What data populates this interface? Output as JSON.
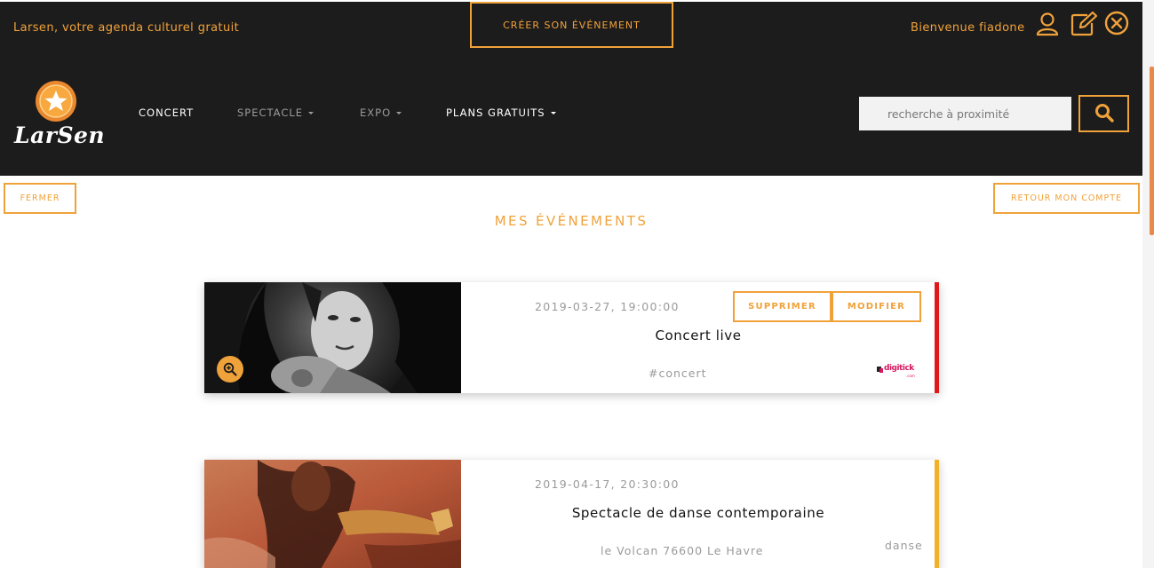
{
  "header": {
    "tagline": "Larsen, votre agenda culturel gratuit",
    "create_event_label": "CRÉER SON ÉVÉNEMENT",
    "welcome": "Bienvenue fiadone",
    "logo_text": "LarSen",
    "icons": [
      "user-icon",
      "edit-icon",
      "close-circle-icon"
    ]
  },
  "nav": {
    "items": [
      {
        "label": "CONCERT",
        "dropdown": false,
        "active": true
      },
      {
        "label": "SPECTACLE",
        "dropdown": true,
        "active": false
      },
      {
        "label": "EXPO",
        "dropdown": true,
        "active": false
      },
      {
        "label": "PLANS GRATUITS",
        "dropdown": true,
        "active": true
      }
    ]
  },
  "search": {
    "placeholder": "recherche à proximité",
    "value": ""
  },
  "subbar": {
    "close_label": "FERMER",
    "back_label": "RETOUR MON COMPTE"
  },
  "page": {
    "title": "MES ÉVÉNEMENTS"
  },
  "events": [
    {
      "datetime": "2019-03-27, 19:00:00",
      "title": "Concert live",
      "tag": "#concert",
      "delete_label": "SUPPRIMER",
      "edit_label": "MODIFIER",
      "partner": "digitick",
      "partner_sub": ".com",
      "accent_color": "#e01818"
    },
    {
      "datetime": "2019-04-17, 20:30:00",
      "title": "Spectacle de danse contemporaine",
      "location": "le Volcan 76600 Le Havre",
      "tag": "danse",
      "accent_color": "#f3b12a"
    }
  ],
  "colors": {
    "accent": "#f0a23a",
    "header_bg": "#1d1c1c"
  }
}
